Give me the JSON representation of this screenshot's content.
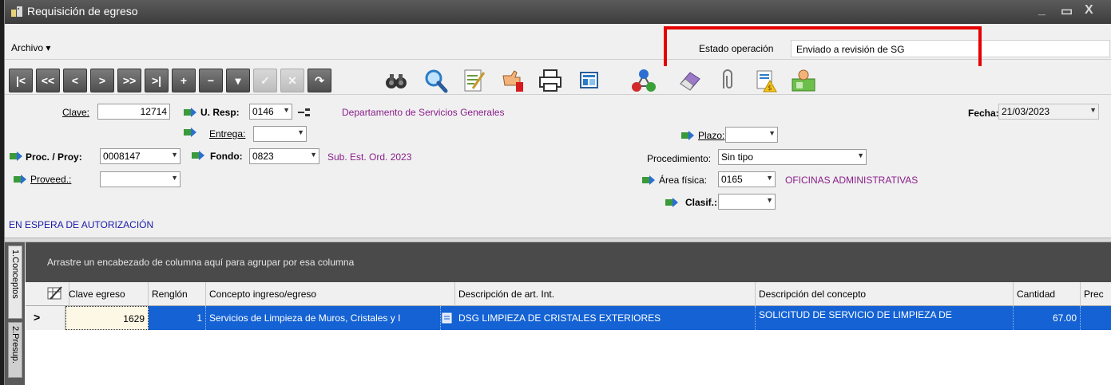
{
  "window": {
    "title": "Requisición de egreso",
    "minimize": "_",
    "maximize": "▭",
    "close": "X"
  },
  "menu": {
    "archivo": "Archivo ▾"
  },
  "status": {
    "label": "Estado operación",
    "value": "Enviado a revisión de SG"
  },
  "toolbar": {
    "nav": [
      "|<",
      "<<",
      "<",
      ">",
      ">>",
      ">|",
      "+",
      "−",
      "▾",
      "✓",
      "✕",
      "↷"
    ],
    "icons": [
      "binoculars-icon",
      "search-icon",
      "edit-document-icon",
      "thumbs-down-icon",
      "print-icon",
      "export-icon",
      "workflow-icon",
      "eraser-icon",
      "attach-icon",
      "budget-icon",
      "user-card-icon"
    ]
  },
  "form": {
    "clave_label": "Clave:",
    "clave_value": "12714",
    "uresp_label": "U. Resp:",
    "uresp_value": "0146",
    "uresp_desc": "Departamento de Servicios Generales",
    "entrega_label": "Entrega:",
    "proc_label": "Proc. / Proy:",
    "proc_value": "0008147",
    "fondo_label": "Fondo:",
    "fondo_value": "0823",
    "fondo_desc": "Sub. Est. Ord. 2023",
    "proveed_label": "Proveed.:",
    "plazo_label": "Plazo:",
    "procedimiento_label": "Procedimiento:",
    "procedimiento_value": "Sin tipo",
    "area_label": "Área física:",
    "area_value": "0165",
    "area_desc": "OFICINAS ADMINISTRATIVAS",
    "clasif_label": "Clasif.:",
    "fecha_label": "Fecha:",
    "fecha_value": "21/03/2023",
    "status_text": "EN ESPERA DE AUTORIZACIÓN"
  },
  "tabs": [
    "1.Conceptos",
    "2.Presup."
  ],
  "grid": {
    "group_hint": "Arrastre un encabezado de columna aquí para agrupar por esa columna",
    "columns": [
      "Clave egreso",
      "Renglón",
      "Concepto ingreso/egreso",
      "Descripción de art. Int.",
      "Descripción del concepto",
      "Cantidad",
      "Prec"
    ],
    "rows": [
      {
        "indicator": ">",
        "clave_egreso": "1629",
        "renglon": "1",
        "concepto": "Servicios de Limpieza de Muros, Cristales y I",
        "descripcion_art": "DSG LIMPIEZA DE CRISTALES EXTERIORES",
        "descripcion_concepto": "SOLICITUD DE SERVICIO DE LIMPIEZA DE",
        "cantidad": "67.00"
      }
    ]
  },
  "colors": {
    "highlight_box": "#e60000",
    "arrow": "#e60000",
    "selected_row": "#1462d4",
    "link_text": "#8a1e8a"
  }
}
